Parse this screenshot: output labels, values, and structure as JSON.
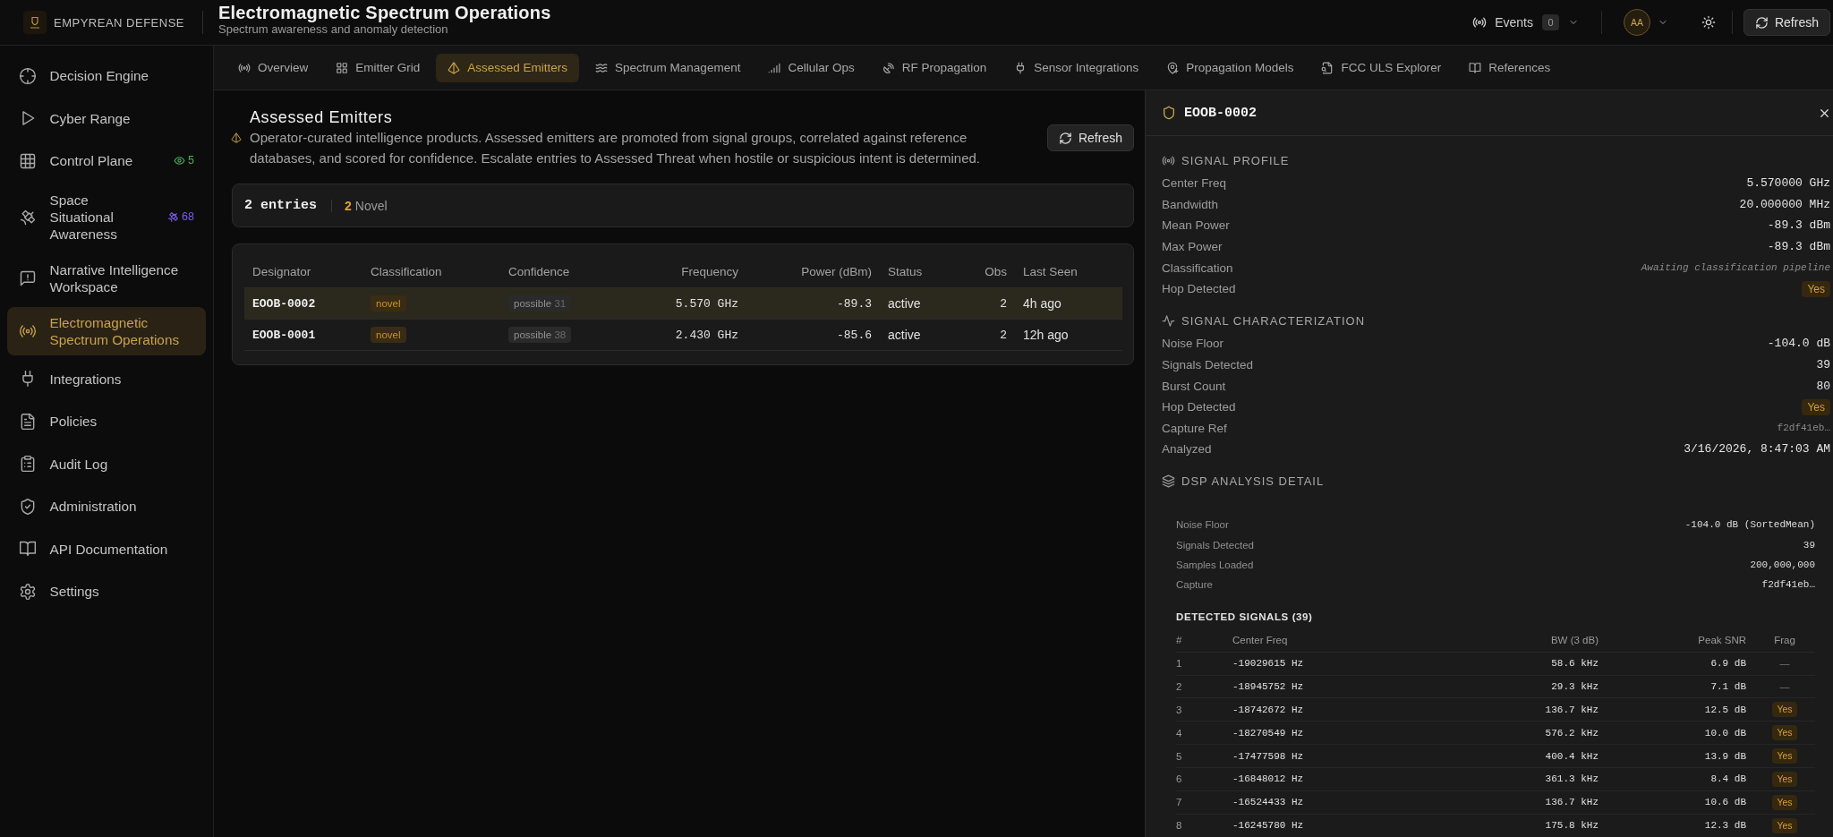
{
  "brand": {
    "name": "EMPYREAN DEFENSE"
  },
  "header": {
    "title": "Electromagnetic Spectrum Operations",
    "subtitle": "Spectrum awareness and anomaly detection",
    "events": {
      "label": "Events",
      "count": "0"
    },
    "user": {
      "initials": "AA"
    },
    "refresh_button": "Refresh"
  },
  "sidebar": {
    "items": [
      {
        "label": "Decision Engine",
        "selected": false
      },
      {
        "label": "Cyber Range",
        "selected": false
      },
      {
        "label": "Control Plane",
        "selected": false,
        "badge": {
          "count": "5",
          "color": "#4cb05a"
        }
      },
      {
        "label": "Space Situational Awareness",
        "selected": false,
        "badge": {
          "count": "68",
          "color": "#7c5cf0"
        }
      },
      {
        "label": "Narrative Intelligence Workspace",
        "selected": false
      },
      {
        "label": "Electromagnetic Spectrum Operations",
        "selected": true
      },
      {
        "label": "Integrations",
        "selected": false
      },
      {
        "label": "Policies",
        "selected": false
      },
      {
        "label": "Audit Log",
        "selected": false
      },
      {
        "label": "Administration",
        "selected": false
      },
      {
        "label": "API Documentation",
        "selected": false
      },
      {
        "label": "Settings",
        "selected": false
      }
    ]
  },
  "tabs": [
    {
      "label": "Overview",
      "selected": false
    },
    {
      "label": "Emitter Grid",
      "selected": false
    },
    {
      "label": "Assessed Emitters",
      "selected": true
    },
    {
      "label": "Spectrum Management",
      "selected": false
    },
    {
      "label": "Cellular Ops",
      "selected": false
    },
    {
      "label": "RF Propagation",
      "selected": false
    },
    {
      "label": "Sensor Integrations",
      "selected": false
    },
    {
      "label": "Propagation Models",
      "selected": false
    },
    {
      "label": "FCC ULS Explorer",
      "selected": false
    },
    {
      "label": "References",
      "selected": false
    }
  ],
  "assessed_emitters": {
    "title": "Assessed Emitters",
    "description": "Operator-curated intelligence products. Assessed emitters are promoted from signal groups, correlated against reference databases, and scored for confidence. Escalate entries to Assessed Threat when hostile or suspicious intent is determined.",
    "refresh_button": "Refresh",
    "summary": {
      "total": "2 entries",
      "novel_count": "2",
      "novel_label": "Novel"
    },
    "table": {
      "columns": [
        "Designator",
        "Classification",
        "Confidence",
        "Frequency",
        "Power (dBm)",
        "Status",
        "Obs",
        "Last Seen"
      ],
      "rows": [
        {
          "designator": "EOOB-0002",
          "classification": "novel",
          "confidence": "possible",
          "confidence_score": "31",
          "frequency": "5.570 GHz",
          "power": "-89.3",
          "status": "active",
          "obs": "2",
          "last_seen": "4h ago",
          "selected": true
        },
        {
          "designator": "EOOB-0001",
          "classification": "novel",
          "confidence": "possible",
          "confidence_score": "38",
          "frequency": "2.430 GHz",
          "power": "-85.6",
          "status": "active",
          "obs": "2",
          "last_seen": "12h ago",
          "selected": false
        }
      ]
    }
  },
  "detail_panel": {
    "title": "EOOB-0002",
    "sections": [
      {
        "title": "SIGNAL PROFILE",
        "rows": [
          {
            "label": "Center Freq",
            "value": "5.570000 GHz",
            "kind": "mono"
          },
          {
            "label": "Bandwidth",
            "value": "20.000000 MHz",
            "kind": "mono"
          },
          {
            "label": "Mean Power",
            "value": "-89.3 dBm",
            "kind": "mono"
          },
          {
            "label": "Max Power",
            "value": "-89.3 dBm",
            "kind": "mono"
          },
          {
            "label": "Classification",
            "value": "Awaiting classification pipeline",
            "kind": "pending"
          },
          {
            "label": "Hop Detected",
            "value": "Yes",
            "kind": "badge"
          }
        ]
      },
      {
        "title": "SIGNAL CHARACTERIZATION",
        "rows": [
          {
            "label": "Noise Floor",
            "value": "-104.0 dB",
            "kind": "mono"
          },
          {
            "label": "Signals Detected",
            "value": "39",
            "kind": "mono"
          },
          {
            "label": "Burst Count",
            "value": "80",
            "kind": "mono"
          },
          {
            "label": "Hop Detected",
            "value": "Yes",
            "kind": "badge"
          },
          {
            "label": "Capture Ref",
            "value": "f2df41eb…",
            "kind": "ref"
          },
          {
            "label": "Analyzed",
            "value": "3/16/2026, 8:47:03 AM",
            "kind": "mono"
          }
        ]
      }
    ],
    "dsp": {
      "title": "DSP ANALYSIS DETAIL",
      "rows": [
        {
          "label": "Noise Floor",
          "value": "-104.0 dB (SortedMean)"
        },
        {
          "label": "Signals Detected",
          "value": "39"
        },
        {
          "label": "Samples Loaded",
          "value": "200,000,000"
        },
        {
          "label": "Capture",
          "value": "f2df41eb…"
        }
      ],
      "signals_title": "DETECTED SIGNALS (39)",
      "signals_columns": [
        "#",
        "Center Freq",
        "BW (3 dB)",
        "Peak SNR",
        "Frag"
      ],
      "signals": [
        {
          "index": "1",
          "center_freq": "-19029615 Hz",
          "bw": "58.6 kHz",
          "peak_snr": "6.9 dB",
          "frag": "—",
          "flagged": false
        },
        {
          "index": "2",
          "center_freq": "-18945752 Hz",
          "bw": "29.3 kHz",
          "peak_snr": "7.1 dB",
          "frag": "—",
          "flagged": false
        },
        {
          "index": "3",
          "center_freq": "-18742672 Hz",
          "bw": "136.7 kHz",
          "peak_snr": "12.5 dB",
          "frag": "Yes",
          "flagged": true
        },
        {
          "index": "4",
          "center_freq": "-18270549 Hz",
          "bw": "576.2 kHz",
          "peak_snr": "10.0 dB",
          "frag": "Yes",
          "flagged": true
        },
        {
          "index": "5",
          "center_freq": "-17477598 Hz",
          "bw": "400.4 kHz",
          "peak_snr": "13.9 dB",
          "frag": "Yes",
          "flagged": true
        },
        {
          "index": "6",
          "center_freq": "-16848012 Hz",
          "bw": "361.3 kHz",
          "peak_snr": "8.4 dB",
          "frag": "Yes",
          "flagged": true
        },
        {
          "index": "7",
          "center_freq": "-16524433 Hz",
          "bw": "136.7 kHz",
          "peak_snr": "10.6 dB",
          "frag": "Yes",
          "flagged": true
        },
        {
          "index": "8",
          "center_freq": "-16245780 Hz",
          "bw": "175.8 kHz",
          "peak_snr": "12.3 dB",
          "frag": "Yes",
          "flagged": true
        }
      ]
    }
  }
}
